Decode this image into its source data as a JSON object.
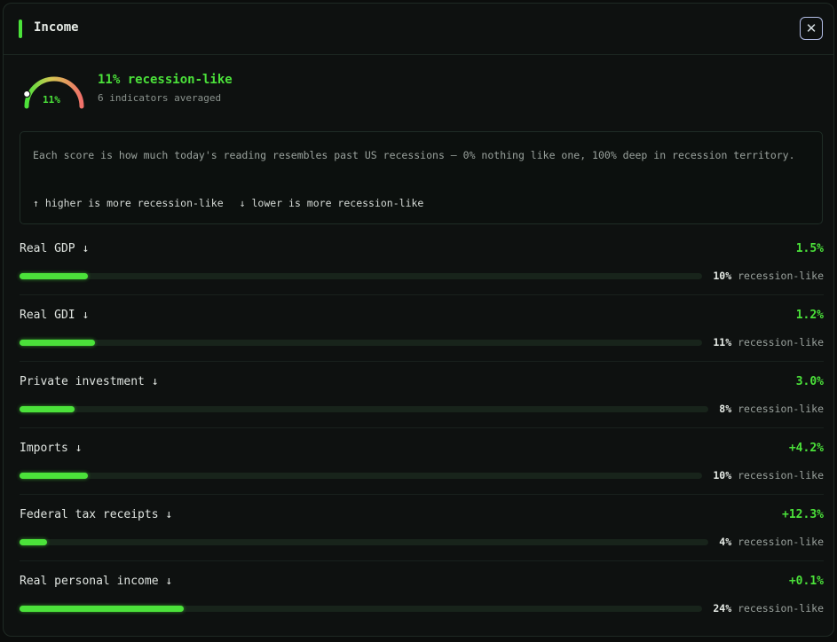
{
  "header": {
    "title": "Income",
    "close_label": "✕"
  },
  "summary": {
    "gauge_label": "11%",
    "gauge_fraction": 0.11,
    "title": "11% recession-like",
    "subtitle": "6 indicators averaged"
  },
  "info": {
    "text": "Each score is how much today's reading resembles past US recessions — 0% nothing like one, 100% deep in recession territory.",
    "legend_up": "↑ higher is more recession-like",
    "legend_down": "↓ lower is more recession-like"
  },
  "score_suffix": "recession-like",
  "colors": {
    "accent": "#4be23a",
    "track": "#18241b",
    "gauge_hot": "#f0706a"
  },
  "indicators": [
    {
      "label": "Real GDP ↓",
      "value": "1.5%",
      "score": "10%",
      "fraction": 0.1
    },
    {
      "label": "Real GDI ↓",
      "value": "1.2%",
      "score": "11%",
      "fraction": 0.11
    },
    {
      "label": "Private investment ↓",
      "value": "3.0%",
      "score": "8%",
      "fraction": 0.08
    },
    {
      "label": "Imports ↓",
      "value": "+4.2%",
      "score": "10%",
      "fraction": 0.1
    },
    {
      "label": "Federal tax receipts ↓",
      "value": "+12.3%",
      "score": "4%",
      "fraction": 0.04
    },
    {
      "label": "Real personal income ↓",
      "value": "+0.1%",
      "score": "24%",
      "fraction": 0.24
    }
  ]
}
